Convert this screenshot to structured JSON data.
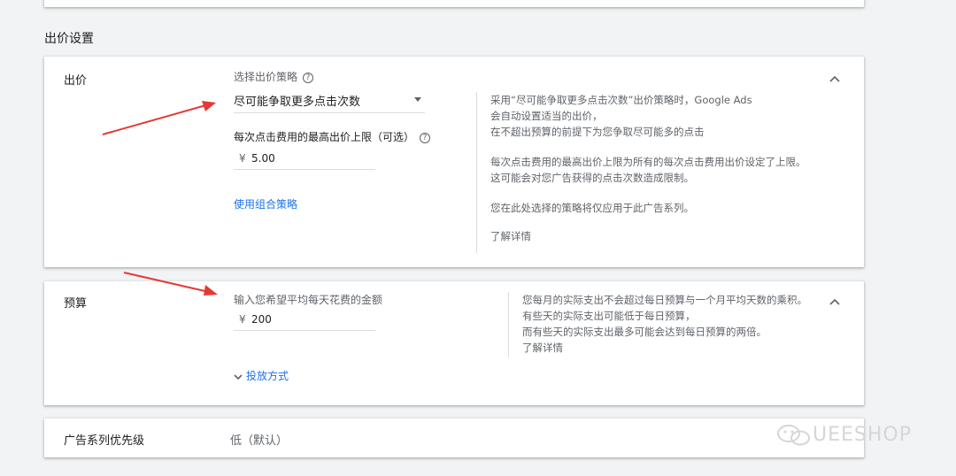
{
  "section_title": "出价设置",
  "bid": {
    "label": "出价",
    "strategy_label": "选择出价策略",
    "strategy_value": "尽可能争取更多点击次数",
    "max_cpc_label": "每次点击费用的最高出价上限（可选）",
    "currency": "¥",
    "max_cpc_value": "5.00",
    "portfolio_link": "使用组合策略",
    "help_lines_1": [
      "采用“尽可能争取更多点击次数”出价策略时，Google Ads",
      "会自动设置适当的出价，",
      "在不超出预算的前提下为您争取尽可能多的点击"
    ],
    "help_lines_2": [
      "每次点击费用的最高出价上限为所有的每次点击费用出价设定了上限。",
      "这可能会对您广告获得的点击次数造成限制。"
    ],
    "help_lines_3": [
      "您在此处选择的策略将仅应用于此广告系列。"
    ],
    "learn_more": "了解详情"
  },
  "budget": {
    "label": "预算",
    "input_label": "输入您希望平均每天花费的金额",
    "currency": "¥",
    "value": "200",
    "delivery_link": "投放方式",
    "help_lines": [
      "您每月的实际支出不会超过每日预算与一个月平均天数的乘积。",
      "有些天的实际支出可能低于每日预算，",
      "而有些天的实际支出最多可能会达到每日预算的两倍。"
    ],
    "learn_more": "了解详情"
  },
  "priority": {
    "label": "广告系列优先级",
    "value": "低（默认）"
  },
  "watermark": "UEESHOP",
  "colors": {
    "link": "#1a73e8",
    "arrow": "#e53935"
  }
}
